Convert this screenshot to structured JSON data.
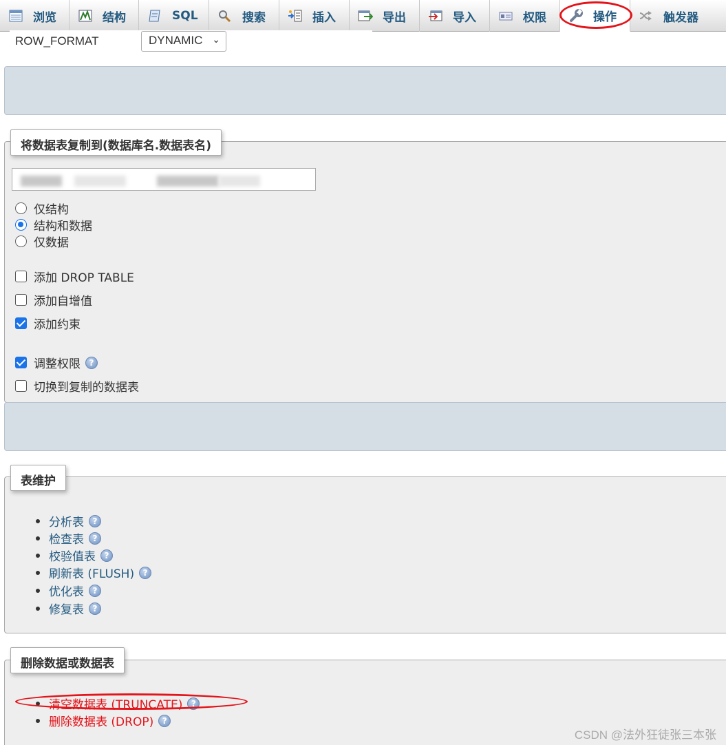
{
  "tabs": [
    {
      "label": "浏览",
      "icon": "browse-icon"
    },
    {
      "label": "结构",
      "icon": "structure-icon"
    },
    {
      "label": "SQL",
      "icon": "sql-icon"
    },
    {
      "label": "搜索",
      "icon": "search-icon"
    },
    {
      "label": "插入",
      "icon": "insert-icon"
    },
    {
      "label": "导出",
      "icon": "export-icon"
    },
    {
      "label": "导入",
      "icon": "import-icon"
    },
    {
      "label": "权限",
      "icon": "privileges-icon"
    },
    {
      "label": "操作",
      "icon": "wrench-icon",
      "active": true
    },
    {
      "label": "触发器",
      "icon": "triggers-icon"
    }
  ],
  "row_format": {
    "label": "ROW_FORMAT",
    "value": "DYNAMIC"
  },
  "copy_table": {
    "legend": "将数据表复制到(数据库名.数据表名)",
    "radios": [
      {
        "label": "仅结构",
        "checked": false
      },
      {
        "label": "结构和数据",
        "checked": true
      },
      {
        "label": "仅数据",
        "checked": false
      }
    ],
    "checks_a": [
      {
        "label": "添加 DROP TABLE",
        "checked": false
      },
      {
        "label": "添加自增值",
        "checked": false
      },
      {
        "label": "添加约束",
        "checked": true
      }
    ],
    "checks_b": [
      {
        "label": "调整权限",
        "checked": true,
        "help": true
      },
      {
        "label": "切换到复制的数据表",
        "checked": false
      }
    ]
  },
  "maintenance": {
    "legend": "表维护",
    "items": [
      "分析表",
      "检查表",
      "校验值表",
      "刷新表 (FLUSH)",
      "优化表",
      "修复表"
    ]
  },
  "delete": {
    "legend": "删除数据或数据表",
    "items": [
      "清空数据表 (TRUNCATE)",
      "删除数据表 (DROP)"
    ]
  },
  "watermark": "CSDN @法外狂徒张三本张",
  "colors": {
    "link": "#235a81",
    "danger": "#e3141a",
    "panel": "#d5dde5",
    "fieldset": "#eeeeee",
    "annotation": "#e3141a"
  }
}
